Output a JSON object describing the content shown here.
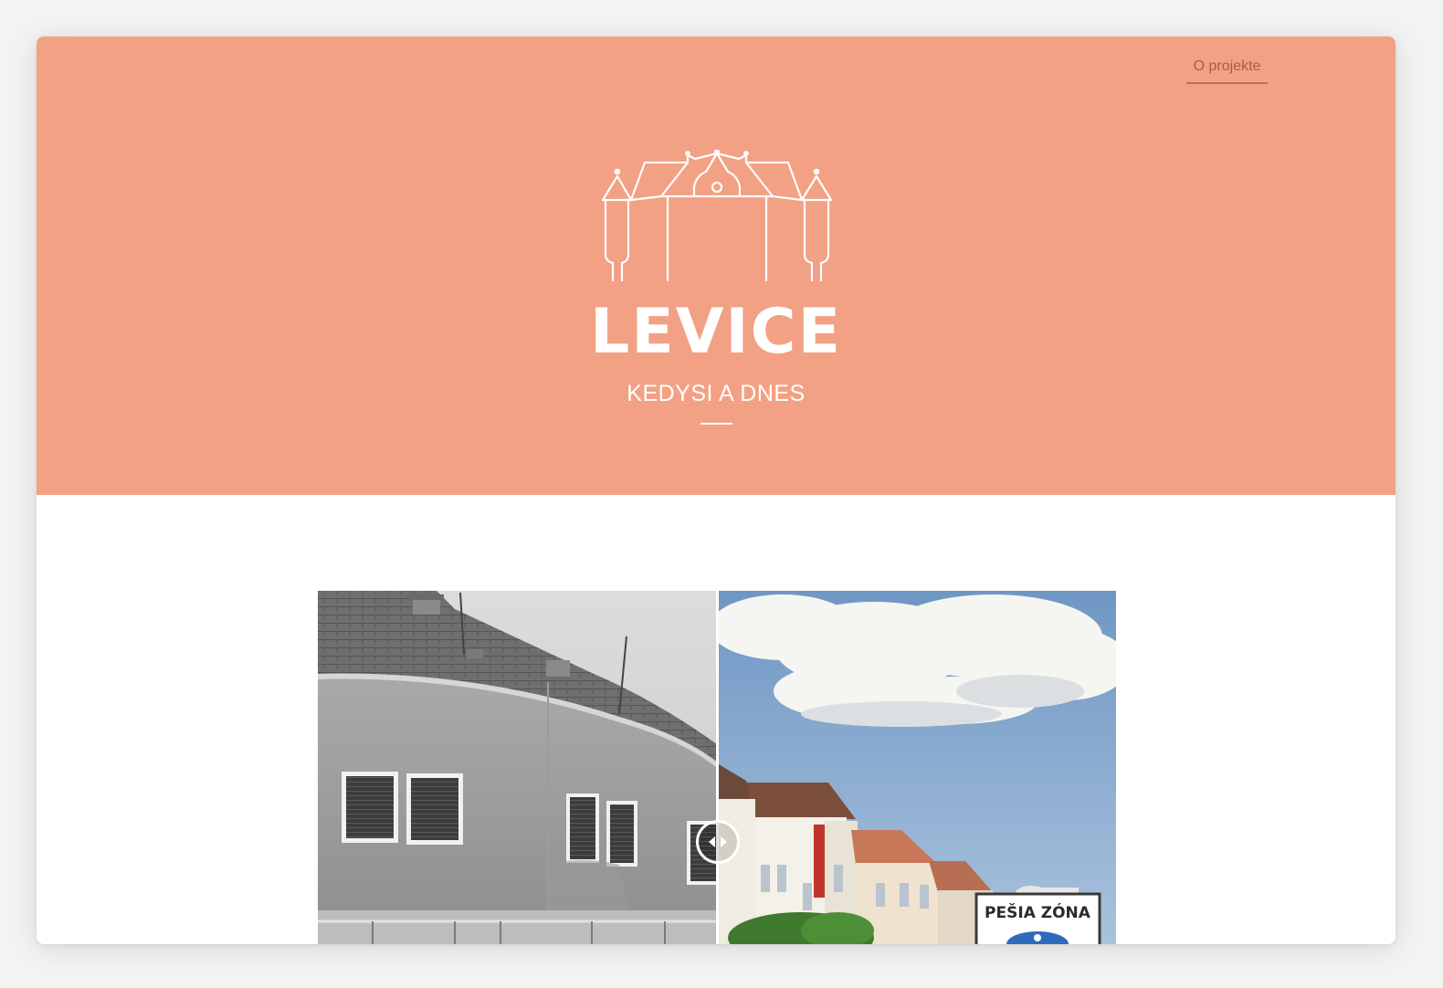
{
  "nav": {
    "about_label": "O projekte"
  },
  "hero": {
    "title": "LEVICE",
    "subtitle": "KEDYSI A DNES",
    "background_color": "#f2a184",
    "logo_icon": "castle-icon"
  },
  "comparison": {
    "before_image": "black-and-white-building-photo",
    "after_image": "color-building-photo",
    "slider_position": 0.5,
    "sign_text": "PEŠIA ZÓNA",
    "handle_icon": "left-right-arrows-icon"
  }
}
